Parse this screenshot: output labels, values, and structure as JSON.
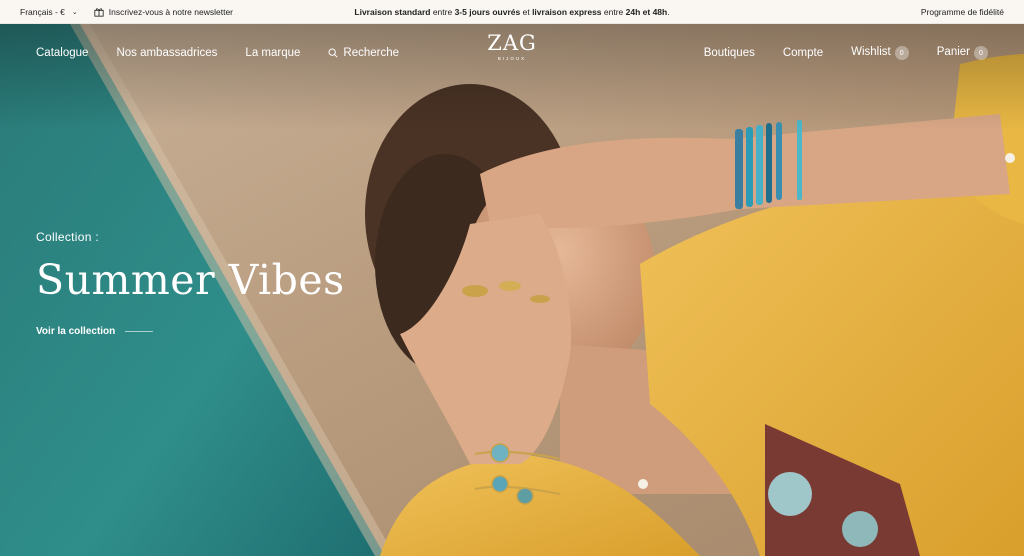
{
  "topbar": {
    "language": "Français - €",
    "newsletter": "Inscrivez-vous à notre newsletter",
    "shipping": {
      "part1": "Livraison standard",
      "part2": " entre ",
      "part3": "3-5 jours ouvrés",
      "part4": " et ",
      "part5": "livraison express",
      "part6": " entre ",
      "part7": "24h et 48h",
      "part8": "."
    },
    "loyalty": "Programme de fidélité"
  },
  "nav": {
    "left": [
      "Catalogue",
      "Nos ambassadrices",
      "La marque"
    ],
    "search": "Recherche",
    "right": [
      "Boutiques",
      "Compte"
    ],
    "wishlist": "Wishlist",
    "wishlist_count": "0",
    "cart": "Panier",
    "cart_count": "0"
  },
  "logo": {
    "mark": "ZAG",
    "sub": "BIJOUX"
  },
  "hero": {
    "kicker": "Collection :",
    "title": "Summer Vibes",
    "cta": "Voir la collection"
  },
  "colors": {
    "pool": "#2e8b87",
    "stone": "#bfa88d",
    "shirt": "#e9b43f",
    "skin": "#d9a988",
    "hair": "#4a3325"
  }
}
